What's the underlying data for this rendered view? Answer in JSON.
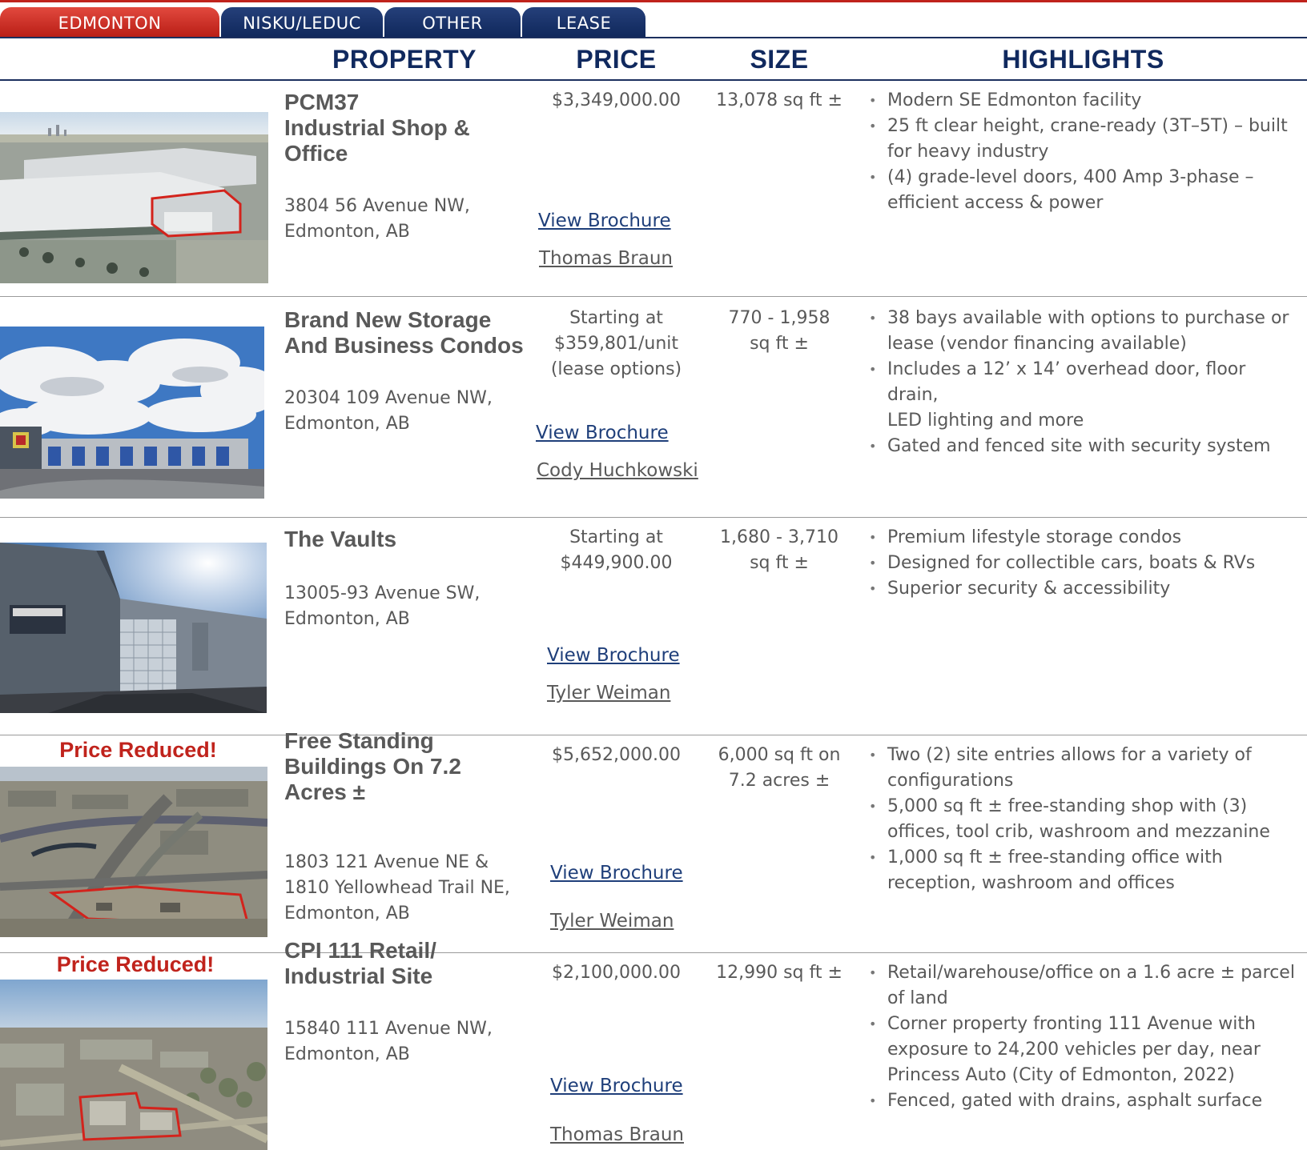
{
  "tabs": [
    {
      "label": "EDMONTON",
      "active": true
    },
    {
      "label": "NISKU/LEDUC",
      "active": false
    },
    {
      "label": "OTHER",
      "active": false
    },
    {
      "label": "LEASE",
      "active": false
    }
  ],
  "headers": {
    "property": "PROPERTY",
    "price": "PRICE",
    "size": "SIZE",
    "highlights": "HIGHLIGHTS"
  },
  "colors": {
    "accent_red": "#c0231c",
    "navy": "#10295e",
    "link_blue": "#1f3f7a",
    "text_gray": "#595959"
  },
  "listings": [
    {
      "badge": "",
      "name": [
        "PCM37",
        "Industrial Shop &",
        "Office"
      ],
      "address": [
        "3804 56 Avenue NW,",
        "Edmonton, AB"
      ],
      "price": [
        "$3,349,000.00"
      ],
      "size": [
        "13,078 sq ft ±"
      ],
      "brochure": "View Brochure",
      "agent": "Thomas Braun",
      "highlights": [
        [
          "Modern SE Edmonton facility"
        ],
        [
          "25 ft clear height, crane-ready (3T–5T) – built",
          "for heavy industry"
        ],
        [
          "(4) grade-level doors, 400 Amp 3-phase –",
          "efficient access & power"
        ]
      ]
    },
    {
      "badge": "",
      "name": [
        "Brand New Storage",
        "And Business Condos"
      ],
      "address": [
        "20304 109 Avenue NW,",
        "Edmonton, AB"
      ],
      "price": [
        "Starting at",
        "$359,801/unit",
        "(lease options)"
      ],
      "size": [
        "770 - 1,958",
        "sq ft ±"
      ],
      "brochure": "View Brochure",
      "agent": "Cody Huchkowski",
      "highlights": [
        [
          "38 bays available with options to purchase or",
          "lease (vendor financing available)"
        ],
        [
          "Includes a 12’ x 14’ overhead door, floor drain,",
          "LED lighting and more"
        ],
        [
          "Gated and fenced site with security system"
        ]
      ]
    },
    {
      "badge": "",
      "name": [
        "The Vaults"
      ],
      "address": [
        "13005-93 Avenue SW,",
        "Edmonton, AB"
      ],
      "price": [
        "Starting at",
        "$449,900.00"
      ],
      "size": [
        "1,680 - 3,710",
        "sq ft ±"
      ],
      "brochure": "View Brochure",
      "agent": "Tyler Weiman",
      "highlights": [
        [
          "Premium lifestyle storage condos"
        ],
        [
          "Designed for collectible cars, boats & RVs"
        ],
        [
          "Superior security & accessibility"
        ]
      ]
    },
    {
      "badge": "Price Reduced!",
      "name": [
        "Free Standing",
        "Buildings On 7.2",
        "Acres ±"
      ],
      "address": [
        "1803 121 Avenue NE &",
        "1810 Yellowhead Trail NE,",
        "Edmonton, AB"
      ],
      "price": [
        "$5,652,000.00"
      ],
      "size": [
        "6,000 sq ft on",
        "7.2 acres ±"
      ],
      "brochure": "View Brochure",
      "agent": "Tyler Weiman",
      "highlights": [
        [
          "Two (2) site entries allows for a variety of",
          "configurations"
        ],
        [
          "5,000 sq ft ± free-standing shop with (3)",
          "offices, tool crib, washroom and mezzanine"
        ],
        [
          "1,000 sq ft ± free-standing office with",
          "reception, washroom and offices"
        ]
      ]
    },
    {
      "badge": "Price Reduced!",
      "name": [
        "CPI 111 Retail/",
        "Industrial Site"
      ],
      "address": [
        "15840 111 Avenue NW,",
        "Edmonton, AB"
      ],
      "price": [
        "$2,100,000.00"
      ],
      "size": [
        "12,990 sq ft ±"
      ],
      "brochure": "View Brochure",
      "agent": "Thomas Braun",
      "highlights": [
        [
          "Retail/warehouse/office on a 1.6 acre ± parcel",
          "of land"
        ],
        [
          "Corner property fronting 111 Avenue with",
          "exposure to 24,200 vehicles per day, near",
          "Princess Auto (City of Edmonton, 2022)"
        ],
        [
          "Fenced, gated with drains, asphalt surface"
        ]
      ]
    }
  ]
}
